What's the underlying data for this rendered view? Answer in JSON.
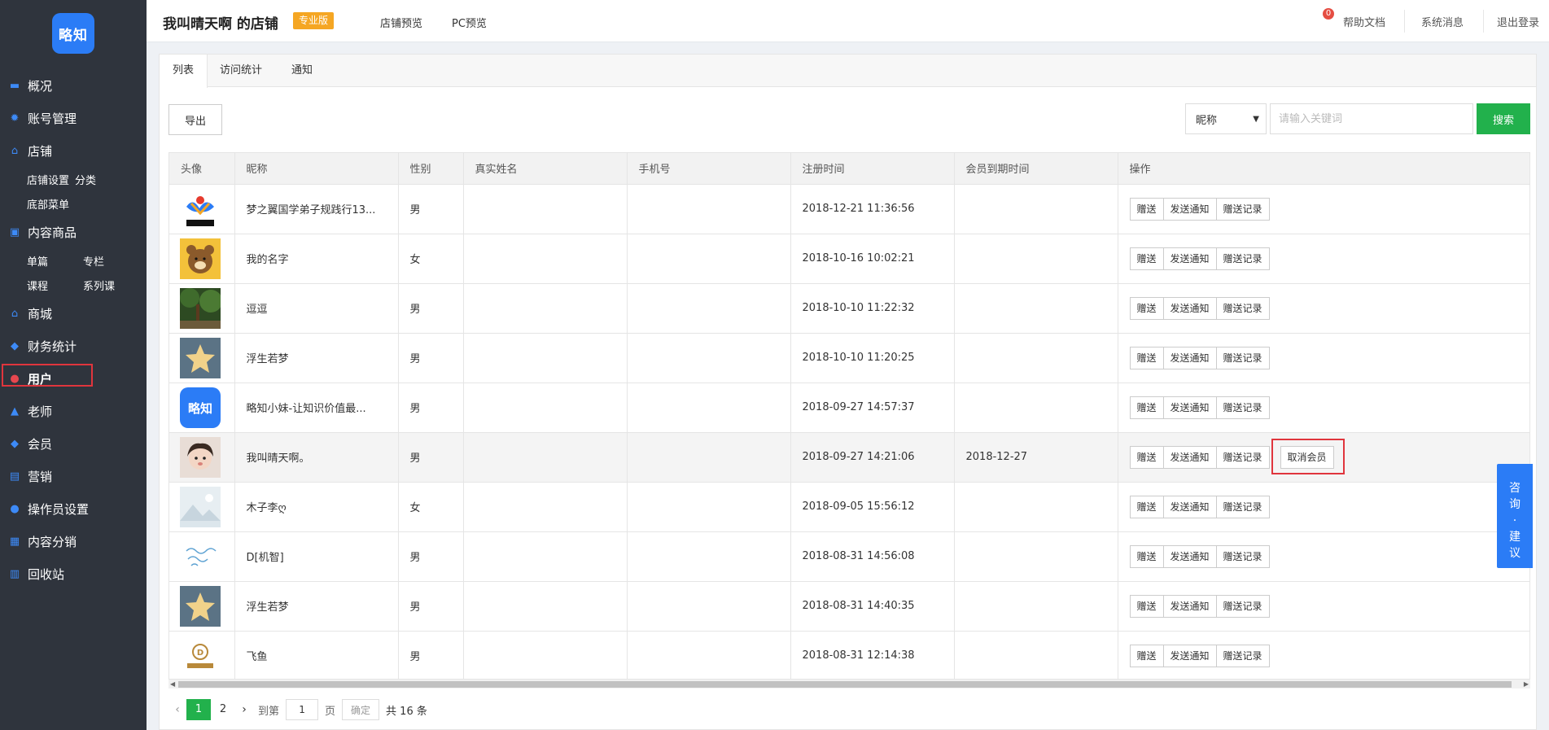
{
  "sidebar": {
    "logo_text": "略知",
    "items": [
      {
        "label": "概况",
        "icon": "folder-icon"
      },
      {
        "label": "账号管理",
        "icon": "gear-icon"
      },
      {
        "label": "店铺",
        "icon": "home-icon"
      },
      {
        "label": "内容商品",
        "icon": "bag-icon"
      },
      {
        "label": "商城",
        "icon": "home-icon"
      },
      {
        "label": "财务统计",
        "icon": "shield-icon"
      },
      {
        "label": "用户",
        "icon": "user-icon"
      },
      {
        "label": "老师",
        "icon": "graduation-cap-icon"
      },
      {
        "label": "会员",
        "icon": "diamond-icon"
      },
      {
        "label": "营销",
        "icon": "chart-icon"
      },
      {
        "label": "操作员设置",
        "icon": "user-plus-icon"
      },
      {
        "label": "内容分销",
        "icon": "share-icon"
      },
      {
        "label": "回收站",
        "icon": "trash-icon"
      }
    ],
    "store_sub": [
      "店铺设置",
      "分类",
      "底部菜单"
    ],
    "content_sub": [
      "单篇",
      "专栏",
      "课程",
      "系列课"
    ]
  },
  "header": {
    "title": "我叫晴天啊 的店铺",
    "badge": "专业版",
    "links": [
      "店铺预览",
      "PC预览"
    ],
    "right": [
      "帮助文档",
      "系统消息",
      "退出登录"
    ],
    "msg_count": "0"
  },
  "tabs": [
    "列表",
    "访问统计",
    "通知"
  ],
  "toolbar": {
    "export": "导出",
    "select_value": "昵称",
    "search_placeholder": "请输入关键词",
    "search": "搜索"
  },
  "table": {
    "columns": [
      "头像",
      "昵称",
      "性别",
      "真实姓名",
      "手机号",
      "注册时间",
      "会员到期时间",
      "操作"
    ],
    "ops": [
      "赠送",
      "发送通知",
      "赠送记录"
    ],
    "cancel_member": "取消会员",
    "rows": [
      {
        "nickname": "梦之翼国学弟子规践行13...",
        "gender": "男",
        "real_name": "",
        "phone": "",
        "reg_time": "2018-12-21 11:36:56",
        "expire": "",
        "avatar": "dream-wings-logo"
      },
      {
        "nickname": "我的名字",
        "gender": "女",
        "real_name": "",
        "phone": "",
        "reg_time": "2018-10-16 10:02:21",
        "expire": "",
        "avatar": "bear-avatar"
      },
      {
        "nickname": "逗逗",
        "gender": "男",
        "real_name": "",
        "phone": "",
        "reg_time": "2018-10-10 11:22:32",
        "expire": "",
        "avatar": "forest-avatar"
      },
      {
        "nickname": "浮生若梦",
        "gender": "男",
        "real_name": "",
        "phone": "",
        "reg_time": "2018-10-10 11:20:25",
        "expire": "",
        "avatar": "star-avatar"
      },
      {
        "nickname": "略知小妹-让知识价值最...",
        "gender": "男",
        "real_name": "",
        "phone": "",
        "reg_time": "2018-09-27 14:57:37",
        "expire": "",
        "avatar": "brand-logo-avatar"
      },
      {
        "nickname": "我叫晴天啊。",
        "gender": "男",
        "real_name": "",
        "phone": "",
        "reg_time": "2018-09-27 14:21:06",
        "expire": "2018-12-27",
        "avatar": "girl-avatar"
      },
      {
        "nickname": "木子李ღ",
        "gender": "女",
        "real_name": "",
        "phone": "",
        "reg_time": "2018-09-05 15:56:12",
        "expire": "",
        "avatar": "landscape-avatar"
      },
      {
        "nickname": "D[机智]",
        "gender": "男",
        "real_name": "",
        "phone": "",
        "reg_time": "2018-08-31 14:56:08",
        "expire": "",
        "avatar": "handwriting-avatar"
      },
      {
        "nickname": "浮生若梦",
        "gender": "男",
        "real_name": "",
        "phone": "",
        "reg_time": "2018-08-31 14:40:35",
        "expire": "",
        "avatar": "star-avatar"
      },
      {
        "nickname": "飞鱼",
        "gender": "男",
        "real_name": "",
        "phone": "",
        "reg_time": "2018-08-31 12:14:38",
        "expire": "",
        "avatar": "gold-logo-avatar"
      }
    ]
  },
  "pager": {
    "pages": [
      "1",
      "2"
    ],
    "goto_label": "到第",
    "page_value": "1",
    "page_label": "页",
    "ok": "确定",
    "total": "共 16 条"
  },
  "feedback": "咨询·建议",
  "colors": {
    "sidebar": "#2f343d",
    "accent": "#2b7cf6",
    "green": "#22b14c",
    "badge": "#f5a623",
    "highlight": "#e0353d"
  }
}
